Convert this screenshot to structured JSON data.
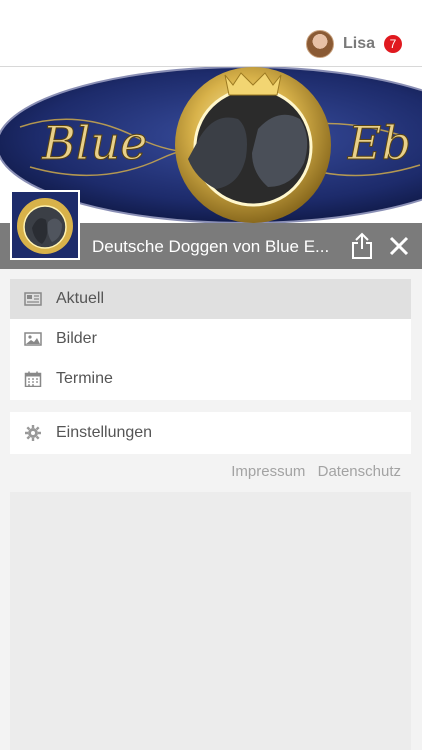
{
  "header": {
    "user_name": "Lisa",
    "notification_count": "7"
  },
  "banner": {
    "logo_text_left": "Blue",
    "logo_text_right": "Eb"
  },
  "titlebar": {
    "title": "Deutsche Doggen von Blue E..."
  },
  "menu": {
    "items": [
      {
        "label": "Aktuell",
        "icon": "newspaper-icon",
        "active": true
      },
      {
        "label": "Bilder",
        "icon": "image-icon",
        "active": false
      },
      {
        "label": "Termine",
        "icon": "calendar-icon",
        "active": false
      }
    ],
    "settings_label": "Einstellungen"
  },
  "footer": {
    "impressum": "Impressum",
    "datenschutz": "Datenschutz"
  },
  "colors": {
    "titlebar": "#7b7b7b",
    "badge": "#e0191f",
    "active_item": "#e0e0e0",
    "banner_blue": "#1d2b6b",
    "banner_gold": "#d8b24a"
  }
}
